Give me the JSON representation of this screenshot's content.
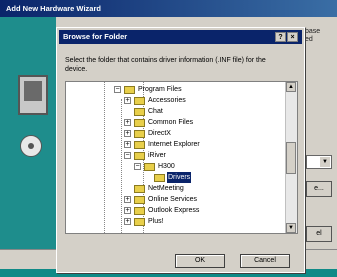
{
  "wizard": {
    "title": "Add New Hardware Wizard",
    "side_text": "base\ned",
    "side_buttons": [
      "e...",
      "el"
    ]
  },
  "dialog": {
    "title": "Browse for Folder",
    "help_label": "?",
    "close_label": "×",
    "instruction": "Select the folder that contains driver information (.INF file) for the device.",
    "ok_label": "OK",
    "cancel_label": "Cancel"
  },
  "tree": {
    "items": [
      {
        "label": "Program Files",
        "expander": "−"
      },
      {
        "label": "Accessories",
        "expander": "+"
      },
      {
        "label": "Chat",
        "expander": ""
      },
      {
        "label": "Common Files",
        "expander": "+"
      },
      {
        "label": "DirectX",
        "expander": "+"
      },
      {
        "label": "Internet Explorer",
        "expander": "+"
      },
      {
        "label": "iRiver",
        "expander": "−"
      },
      {
        "label": "H300",
        "expander": "−"
      },
      {
        "label": "Drivers",
        "expander": "",
        "selected": true
      },
      {
        "label": "NetMeeting",
        "expander": ""
      },
      {
        "label": "Online Services",
        "expander": "+"
      },
      {
        "label": "Outlook Express",
        "expander": "+"
      },
      {
        "label": "Plus!",
        "expander": "+"
      }
    ]
  },
  "scroll_arrows": {
    "up": "▲",
    "down": "▼"
  },
  "colors": {
    "desktop": "#0f8a87",
    "titlebar": "#0a246a",
    "selection": "#0a246a",
    "face": "#d4d0c8"
  }
}
